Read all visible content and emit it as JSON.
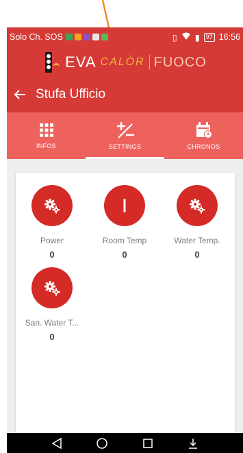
{
  "status_bar": {
    "carrier": "Solo Ch. SOS",
    "battery": "97",
    "time": "16:56"
  },
  "app_header": {
    "logo_eva": "EVA",
    "logo_calor": "CALÒR",
    "logo_fuoco": "FUOCO",
    "title": "Stufa Ufficio"
  },
  "tabs": [
    {
      "label": "INFOS",
      "icon": "grid-dots-icon",
      "active": false
    },
    {
      "label": "SETTINGS",
      "icon": "plus-minus-icon",
      "active": true
    },
    {
      "label": "CHRONOS",
      "icon": "calendar-clock-icon",
      "active": false
    }
  ],
  "params": [
    {
      "label": "Power",
      "value": "0",
      "icon": "gears-icon"
    },
    {
      "label": "Room Temp",
      "value": "0",
      "icon": "thermometer-icon"
    },
    {
      "label": "Water Temp.",
      "value": "0",
      "icon": "gears-icon"
    },
    {
      "label": "San. Water T...",
      "value": "0",
      "icon": "gears-icon"
    }
  ],
  "colors": {
    "primary": "#d63a36",
    "tab_bar": "#ee625e",
    "param_circle": "#d42b27",
    "annotation_arrow": "#f08a2c"
  }
}
